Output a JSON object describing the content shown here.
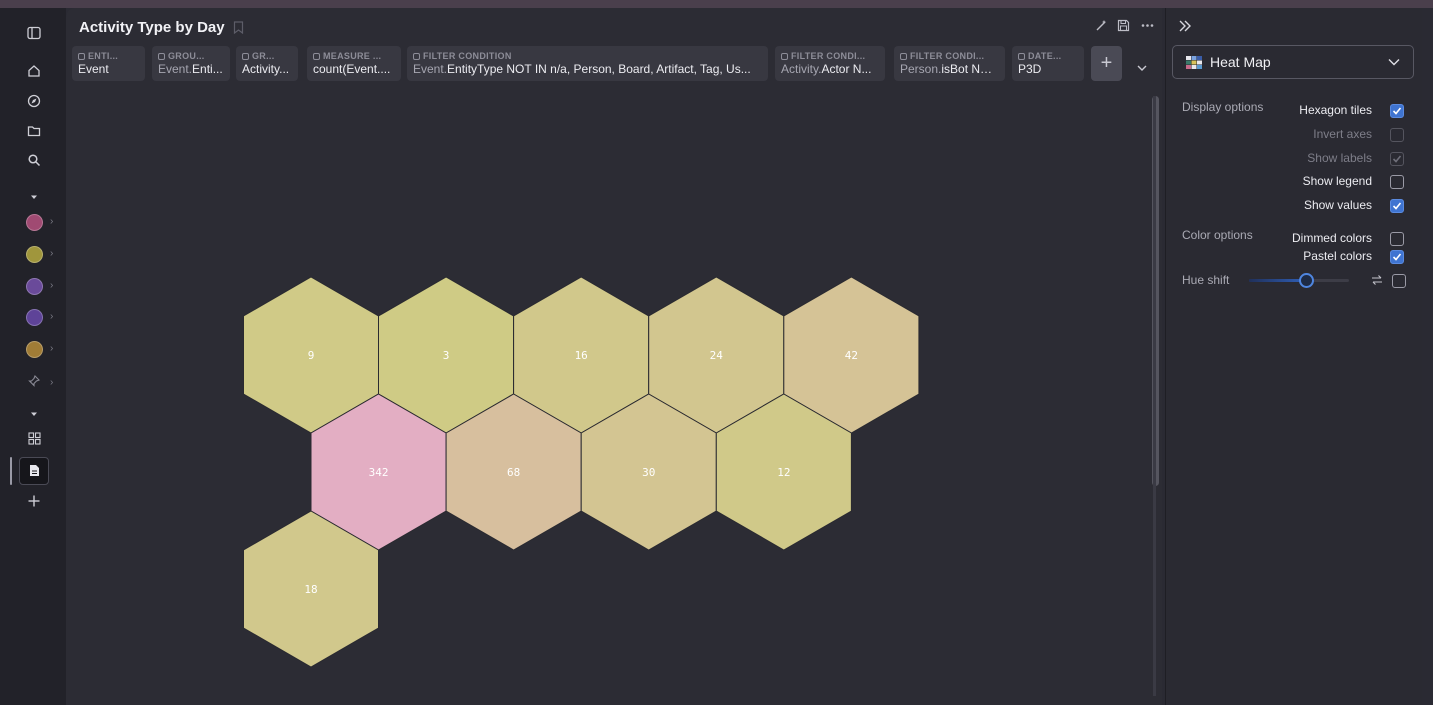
{
  "sidebar": {
    "colors": [
      "#a04a72",
      "#a0963c",
      "#6a4a9a",
      "#5e4398",
      "#a07c36"
    ]
  },
  "header": {
    "title": "Activity Type by Day"
  },
  "filters": [
    {
      "label": "ENTI...",
      "prefix": "",
      "value": "Event"
    },
    {
      "label": "GROU...",
      "prefix": "Event.",
      "value": "Enti..."
    },
    {
      "label": "GR...",
      "prefix": "",
      "value": "Activity..."
    },
    {
      "label": "MEASURE ...",
      "prefix": "",
      "value": "count(Event...."
    },
    {
      "label": "FILTER CONDITION",
      "prefix": "Event.",
      "value": "EntityType NOT IN n/a, Person, Board, Artifact, Tag, Us..."
    },
    {
      "label": "FILTER CONDI...",
      "prefix": "Activity.",
      "value": "Actor N..."
    },
    {
      "label": "FILTER CONDI...",
      "prefix": "Person.",
      "value": "isBot NO..."
    },
    {
      "label": "DATE...",
      "prefix": "",
      "value": "P3D"
    }
  ],
  "add_button": "+",
  "chart_data": {
    "type": "heatmap",
    "tile_shape": "hexagon",
    "rows": [
      [
        9,
        3,
        16,
        24,
        42
      ],
      [
        342,
        68,
        30,
        12
      ],
      [
        18
      ]
    ],
    "colors": {
      "low": "#cfcb85",
      "high": "#e3aec3"
    }
  },
  "panel": {
    "viz_type": "Heat Map",
    "display_section": "Display options",
    "display_options": [
      {
        "label": "Hexagon tiles",
        "checked": true,
        "disabled": false
      },
      {
        "label": "Invert axes",
        "checked": false,
        "disabled": true
      },
      {
        "label": "Show labels",
        "checked": true,
        "disabled": true
      },
      {
        "label": "Show legend",
        "checked": false,
        "disabled": false
      },
      {
        "label": "Show values",
        "checked": true,
        "disabled": false
      }
    ],
    "color_section": "Color options",
    "color_options": [
      {
        "label": "Dimmed colors",
        "checked": false
      },
      {
        "label": "Pastel colors",
        "checked": true
      }
    ],
    "hue_label": "Hue shift",
    "hue_value": 0.57,
    "hue_checked": false
  }
}
